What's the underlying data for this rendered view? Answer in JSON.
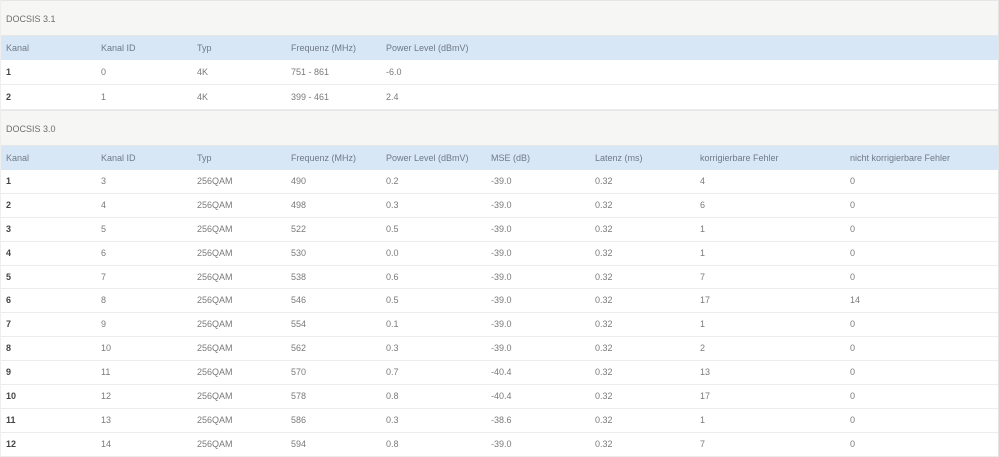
{
  "docsis31": {
    "title": "DOCSIS 3.1",
    "columns": [
      "Kanal",
      "Kanal ID",
      "Typ",
      "Frequenz (MHz)",
      "Power Level (dBmV)"
    ],
    "rows": [
      [
        "1",
        "0",
        "4K",
        "751 - 861",
        "-6.0"
      ],
      [
        "2",
        "1",
        "4K",
        "399 - 461",
        "2.4"
      ]
    ]
  },
  "docsis30": {
    "title": "DOCSIS 3.0",
    "columns": [
      "Kanal",
      "Kanal ID",
      "Typ",
      "Frequenz (MHz)",
      "Power Level (dBmV)",
      "MSE (dB)",
      "Latenz (ms)",
      "korrigierbare Fehler",
      "nicht korrigierbare Fehler"
    ],
    "rows": [
      [
        "1",
        "3",
        "256QAM",
        "490",
        "0.2",
        "-39.0",
        "0.32",
        "4",
        "0"
      ],
      [
        "2",
        "4",
        "256QAM",
        "498",
        "0.3",
        "-39.0",
        "0.32",
        "6",
        "0"
      ],
      [
        "3",
        "5",
        "256QAM",
        "522",
        "0.5",
        "-39.0",
        "0.32",
        "1",
        "0"
      ],
      [
        "4",
        "6",
        "256QAM",
        "530",
        "0.0",
        "-39.0",
        "0.32",
        "1",
        "0"
      ],
      [
        "5",
        "7",
        "256QAM",
        "538",
        "0.6",
        "-39.0",
        "0.32",
        "7",
        "0"
      ],
      [
        "6",
        "8",
        "256QAM",
        "546",
        "0.5",
        "-39.0",
        "0.32",
        "17",
        "14"
      ],
      [
        "7",
        "9",
        "256QAM",
        "554",
        "0.1",
        "-39.0",
        "0.32",
        "1",
        "0"
      ],
      [
        "8",
        "10",
        "256QAM",
        "562",
        "0.3",
        "-39.0",
        "0.32",
        "2",
        "0"
      ],
      [
        "9",
        "11",
        "256QAM",
        "570",
        "0.7",
        "-40.4",
        "0.32",
        "13",
        "0"
      ],
      [
        "10",
        "12",
        "256QAM",
        "578",
        "0.8",
        "-40.4",
        "0.32",
        "17",
        "0"
      ],
      [
        "11",
        "13",
        "256QAM",
        "586",
        "0.3",
        "-38.6",
        "0.32",
        "1",
        "0"
      ],
      [
        "12",
        "14",
        "256QAM",
        "594",
        "0.8",
        "-39.0",
        "0.32",
        "7",
        "0"
      ]
    ]
  }
}
